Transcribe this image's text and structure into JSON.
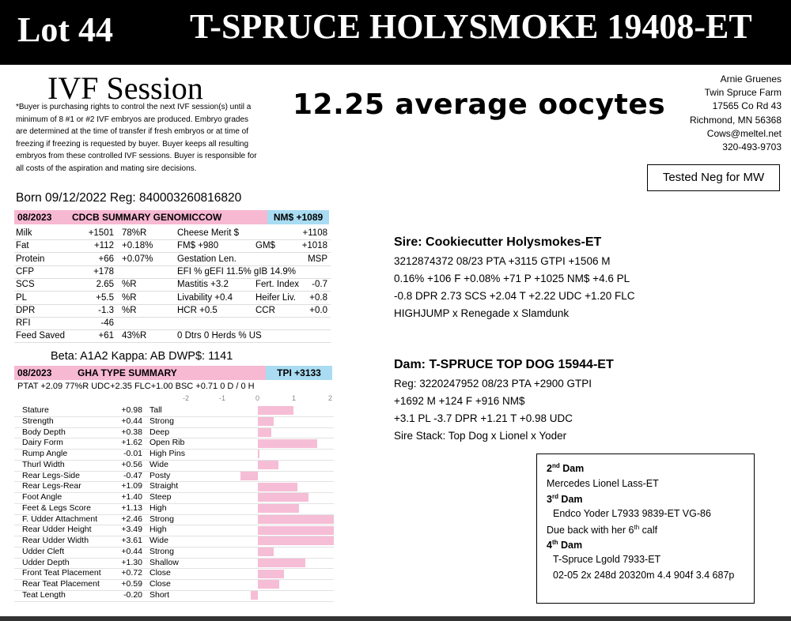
{
  "header": {
    "lot": "Lot 44",
    "name": "T-SPRUCE HOLYSMOKE 19408-ET"
  },
  "ivf": {
    "title": "IVF Session",
    "text": "*Buyer is purchasing rights to control the next IVF session(s) until a minimum of 8 #1 or #2 IVF embryos are produced. Embryo grades are determined at the time of transfer if fresh embryos or at time of freezing if freezing is requested by buyer. Buyer keeps all resulting embryos from these controlled IVF sessions. Buyer is responsible for all costs of the aspiration and mating sire decisions."
  },
  "oocytes": "12.25 average oocytes",
  "owner": [
    "Arnie Gruenes",
    "Twin Spruce Farm",
    "17565 Co Rd 43",
    "Richmond, MN 56368",
    "Cows@meltel.net",
    "320-493-9703"
  ],
  "tested": "Tested Neg for MW",
  "born": "Born 09/12/2022   Reg: 840003260816820",
  "cdcb": {
    "date": "08/2023",
    "title": "CDCB SUMMARY GENOMICCOW",
    "nm": "NM$ +1089",
    "rows": [
      [
        "Milk",
        "+1501",
        "78%R",
        "Cheese Merit $",
        "",
        "+1108"
      ],
      [
        "Fat",
        "+112",
        "+0.18%",
        "FM$ +980",
        "GM$",
        "+1018"
      ],
      [
        "Protein",
        "+66",
        "+0.07%",
        "Gestation Len.",
        "",
        "MSP"
      ],
      [
        "CFP",
        "+178",
        "",
        "EFI %   gEFI  11.5%  gIB  14.9%",
        "",
        ""
      ],
      [
        "SCS",
        "2.65",
        "%R",
        "Mastitis  +3.2",
        "Fert. Index",
        "-0.7"
      ],
      [
        "PL",
        "+5.5",
        "%R",
        "Livability  +0.4",
        "Heifer Liv.",
        "+0.8"
      ],
      [
        "DPR",
        "-1.3",
        "%R",
        "HCR   +0.5",
        "CCR",
        "+0.0"
      ],
      [
        "RFI",
        "-46",
        "",
        "",
        "",
        ""
      ],
      [
        "Feed Saved",
        "+61",
        "43%R",
        "0 Dtrs  0 Herds  % US",
        "",
        ""
      ]
    ]
  },
  "beta": "Beta: A1A2   Kappa: AB   DWP$: 1141",
  "gha": {
    "date": "08/2023",
    "title": "GHA TYPE SUMMARY",
    "tpi": "TPI +3133",
    "ptat": "PTAT +2.09  77%R  UDC+2.35  FLC+1.00  BSC +0.71  0 D / 0 H",
    "axis": [
      "-2",
      "-1",
      "0",
      "1",
      "2"
    ],
    "traits": [
      [
        "Stature",
        "+0.98",
        "Tall",
        0.98
      ],
      [
        "Strength",
        "+0.44",
        "Strong",
        0.44
      ],
      [
        "Body Depth",
        "+0.38",
        "Deep",
        0.38
      ],
      [
        "Dairy Form",
        "+1.62",
        "Open Rib",
        1.62
      ],
      [
        "Rump Angle",
        "-0.01",
        "High Pins",
        -0.01
      ],
      [
        "Thurl Width",
        "+0.56",
        "Wide",
        0.56
      ],
      [
        "Rear Legs-Side",
        "-0.47",
        "Posty",
        -0.47
      ],
      [
        "Rear Legs-Rear",
        "+1.09",
        "Straight",
        1.09
      ],
      [
        "Foot Angle",
        "+1.40",
        "Steep",
        1.4
      ],
      [
        "Feet & Legs Score",
        "+1.13",
        "High",
        1.13
      ],
      [
        "F. Udder Attachment",
        "+2.46",
        "Strong",
        2.46
      ],
      [
        "Rear Udder Height",
        "+3.49",
        "High",
        3.49
      ],
      [
        "Rear Udder Width",
        "+3.61",
        "Wide",
        3.61
      ],
      [
        "Udder Cleft",
        "+0.44",
        "Strong",
        0.44
      ],
      [
        "Udder Depth",
        "+1.30",
        "Shallow",
        1.3
      ],
      [
        "Front Teat Placement",
        "+0.72",
        "Close",
        0.72
      ],
      [
        "Rear Teat Placement",
        "+0.59",
        "Close",
        0.59
      ],
      [
        "Teat Length",
        "-0.20",
        "Short",
        -0.2
      ]
    ]
  },
  "sire": {
    "title": "Sire: Cookiecutter Holysmokes-ET",
    "lines": [
      "3212874372 08/23 PTA +3115 GTPI +1506 M",
      "0.16% +106 F +0.08% +71 P +1025 NM$ +4.6 PL",
      "-0.8 DPR 2.73 SCS +2.04 T +2.22 UDC +1.20 FLC",
      "HIGHJUMP x Renegade x Slamdunk"
    ]
  },
  "dam": {
    "title": "Dam: T-SPRUCE TOP DOG 15944-ET",
    "lines": [
      "Reg: 3220247952 08/23 PTA +2900 GTPI",
      "+1692 M +124 F +916 NM$",
      "+3.1 PL -3.7 DPR +1.21 T +0.98 UDC",
      "Sire Stack: Top Dog x Lionel x Yoder"
    ]
  },
  "pedigree": {
    "dam2_label": "2nd Dam",
    "dam2_name": "Mercedes Lionel Lass-ET",
    "dam3_label": "3rd Dam",
    "dam3_name": "Endco Yoder L7933 9839-ET VG-86",
    "dam3_note": "Due back with her 6th calf",
    "dam4_label": "4th Dam",
    "dam4_name": "T-Spruce Lgold 7933-ET",
    "dam4_record": "02-05 2x 248d 20320m 4.4 904f 3.4 687p"
  },
  "colors": {
    "pink": "#f7b8d2",
    "blue": "#a9dcf2",
    "bar": "#f6bdd6"
  }
}
